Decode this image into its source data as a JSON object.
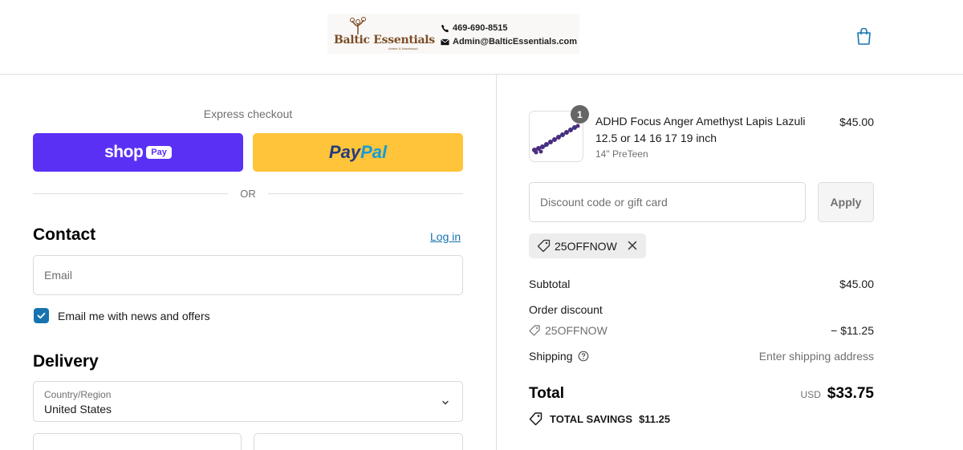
{
  "header": {
    "logo_text": "Baltic Essentials",
    "logo_subtext": "Amber & Hazelwood",
    "phone": "469-690-8515",
    "email": "Admin@BalticEssentials.com",
    "icons": [
      "phone-icon",
      "mail-icon",
      "shopping-bag-icon"
    ]
  },
  "checkout": {
    "express_label": "Express checkout",
    "shop_pay": {
      "word": "shop",
      "pill": "Pay"
    },
    "paypal": {
      "part1": "Pay",
      "part2": "Pal"
    },
    "or_text": "OR",
    "contact": {
      "title": "Contact",
      "login_link": "Log in",
      "email_placeholder": "Email",
      "email_value": "",
      "newsletter_label": "Email me with news and offers",
      "newsletter_checked": true
    },
    "delivery": {
      "title": "Delivery",
      "country_label": "Country/Region",
      "country_value": "United States",
      "first_name_placeholder": "",
      "last_name_placeholder": ""
    }
  },
  "summary": {
    "product": {
      "title": "ADHD Focus Anger Amethyst Lapis Lazuli 12.5 or 14 16 17 19 inch",
      "variant": "14\" PreTeen",
      "price": "$45.00",
      "quantity": "1"
    },
    "discount_placeholder": "Discount code or gift card",
    "apply_label": "Apply",
    "applied_code": "25OFFNOW",
    "subtotal_label": "Subtotal",
    "subtotal_value": "$45.00",
    "order_discount_label": "Order discount",
    "discount_code": "25OFFNOW",
    "discount_value": "− $11.25",
    "shipping_label": "Shipping",
    "shipping_value": "Enter shipping address",
    "total_label": "Total",
    "currency": "USD",
    "total_value": "$33.75",
    "savings_label": "TOTAL SAVINGS",
    "savings_value": "$11.25"
  },
  "colors": {
    "shop_pay": "#5a31f4",
    "paypal": "#ffc439",
    "link": "#1773b0",
    "brand": "#7b4d26"
  }
}
